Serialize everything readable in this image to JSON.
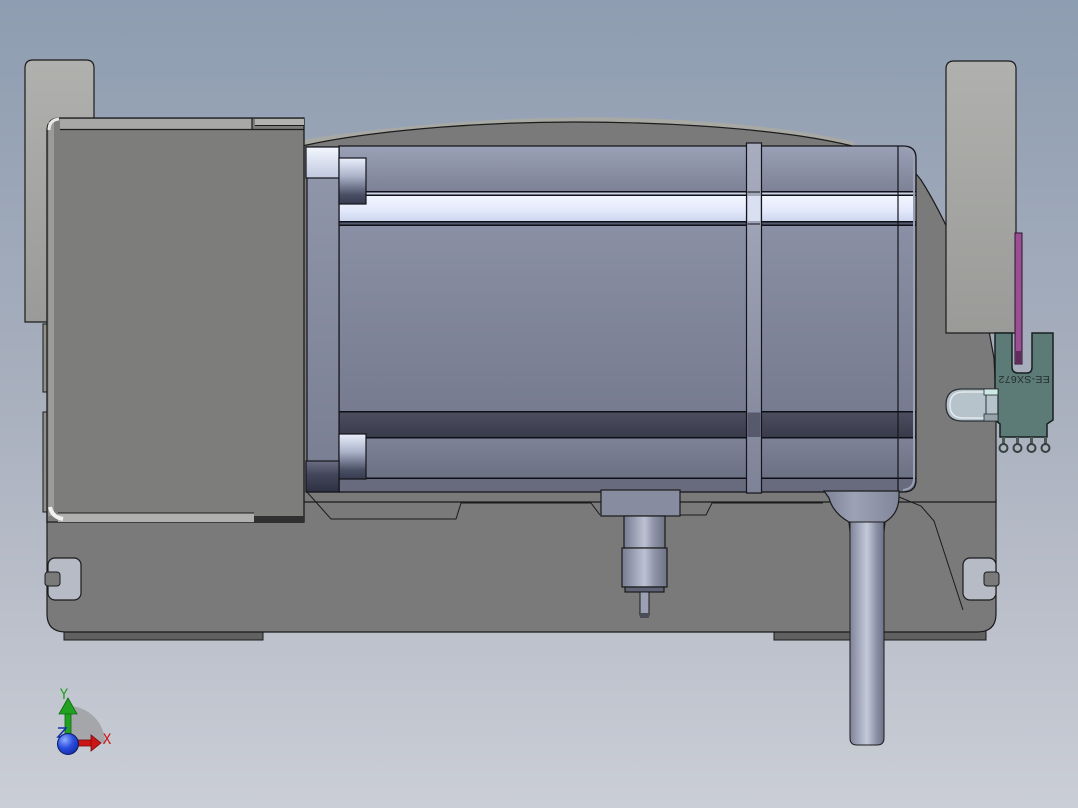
{
  "colors": {
    "bg_top": "#8e9db1",
    "bg_mid": "#a9b0be",
    "bg_bottom": "#cbced6",
    "housing": "#7a7a7a",
    "base_plate": "#7a7a7a",
    "lip_shadow": "#616161",
    "block_face": "#7d7e7b",
    "block_trim_light": "#a8a9a6",
    "tab": "#a5a6a3",
    "notch_interior": "#b6bbc5",
    "motor_body_light": "#9298ad",
    "motor_body_dark": "#6e7387",
    "motor_white_band": "#e9eefc",
    "motor_dark_band": "#404254",
    "flange": "#8a90a6",
    "probe": "#878ca0",
    "cable_mid": "#c4c9da",
    "sensor_body": "#5d7b76",
    "sensor_flag": "#9b4f93",
    "sensor_flag_tip": "#5f2d5a",
    "sensor_connector": "#b7c3cb",
    "outline": "#1b1b1b"
  },
  "sensor": {
    "marking": "EE-SX672"
  },
  "triad": {
    "x_label": "X",
    "y_label": "Y",
    "x_color": "#cc1616",
    "y_color": "#22a022",
    "origin_color": "#1433b0"
  }
}
